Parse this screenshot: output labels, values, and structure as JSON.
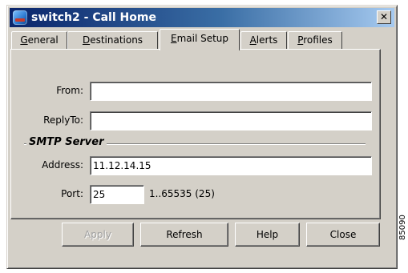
{
  "window": {
    "title": "switch2 - Call Home",
    "close_glyph": "✕",
    "icon": "app-icon",
    "close_icon": "close-icon"
  },
  "tabs": [
    {
      "pre": "",
      "mnemonic": "G",
      "post": "eneral",
      "active": false
    },
    {
      "pre": "",
      "mnemonic": "D",
      "post": "estinations",
      "active": false
    },
    {
      "pre": "",
      "mnemonic": "E",
      "post": "mail Setup",
      "active": true
    },
    {
      "pre": "",
      "mnemonic": "A",
      "post": "lerts",
      "active": false
    },
    {
      "pre": "",
      "mnemonic": "P",
      "post": "rofiles",
      "active": false
    }
  ],
  "form": {
    "from_label": "From:",
    "from_value": "",
    "replyto_label": "ReplyTo:",
    "replyto_value": "",
    "smtp_group": "SMTP Server",
    "address_label": "Address:",
    "address_value": "11.12.14.15",
    "port_label": "Port:",
    "port_value": "25",
    "port_hint": "1..65535 (25)"
  },
  "buttons": {
    "apply": "Apply",
    "refresh": "Refresh",
    "help": "Help",
    "close": "Close"
  },
  "figure_id": "85090"
}
